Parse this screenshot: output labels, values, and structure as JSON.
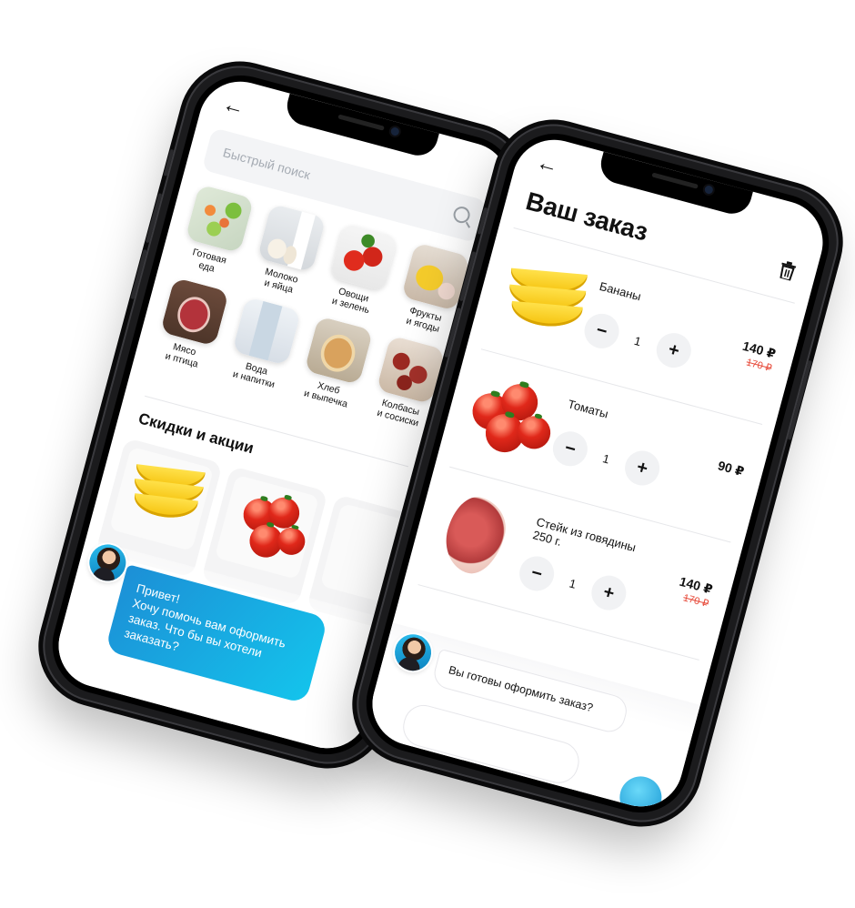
{
  "left_phone": {
    "search": {
      "placeholder": "Быстрый поиск"
    },
    "categories": [
      {
        "label": "Готовая\nеда",
        "icon": "salad-icon"
      },
      {
        "label": "Молоко\nи яйца",
        "icon": "milk-icon"
      },
      {
        "label": "Овощи\nи зелень",
        "icon": "vegetables-icon"
      },
      {
        "label": "Фрукты\nи ягоды",
        "icon": "fruits-icon"
      },
      {
        "label": "Мясо\nи птица",
        "icon": "meat-icon"
      },
      {
        "label": "Вода\nи напитки",
        "icon": "water-icon"
      },
      {
        "label": "Хлеб\nи выпечка",
        "icon": "bread-icon"
      },
      {
        "label": "Колбасы\nи сосиски",
        "icon": "sausage-icon"
      }
    ],
    "section_title": "Скидки и акции",
    "chat": {
      "greeting": "Привет!",
      "message": "Хочу помочь вам оформить заказ. Что бы вы хотели заказать?"
    }
  },
  "right_phone": {
    "title": "Ваш заказ",
    "items": [
      {
        "name": "Бананы",
        "qty": "1",
        "price": "140 ₽",
        "old_price": "170 ₽"
      },
      {
        "name": "Томаты",
        "qty": "1",
        "price": "90 ₽",
        "old_price": ""
      },
      {
        "name": "Стейк из говядины 250 г.",
        "qty": "1",
        "price": "140 ₽",
        "old_price": "170 ₽"
      }
    ],
    "chat": {
      "message": "Вы готовы оформить заказ?"
    }
  },
  "colors": {
    "accent": "#14c4ec",
    "sale": "#e74c3c"
  }
}
